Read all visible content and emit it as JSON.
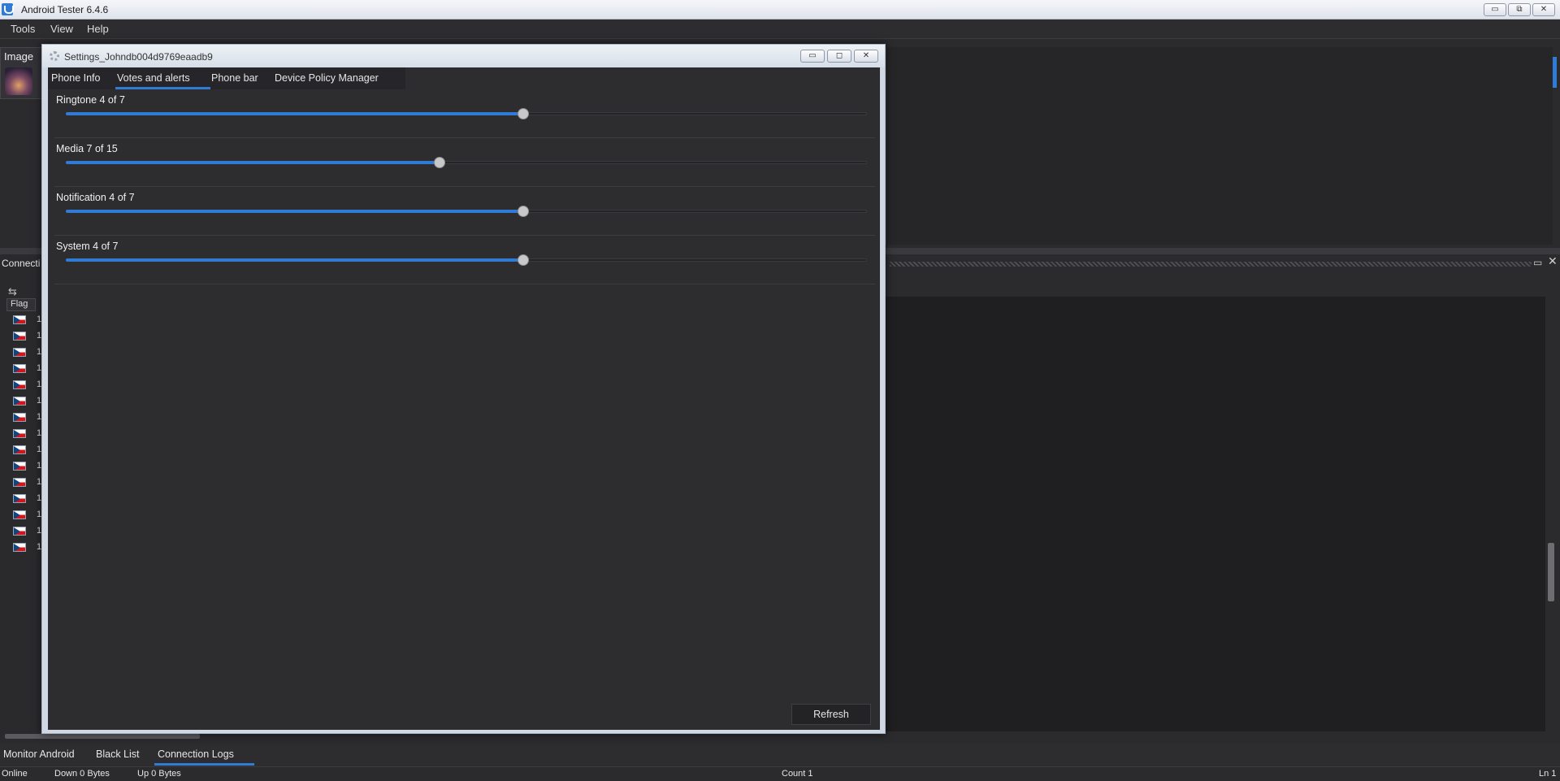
{
  "app": {
    "title": "Android Tester 6.4.6"
  },
  "window_controls": {
    "minimize": "▭",
    "restore": "⧉",
    "close": "✕"
  },
  "menu": [
    "Tools",
    "View",
    "Help"
  ],
  "image_panel": {
    "title": "Image"
  },
  "connection_panel": {
    "title": "Connecti",
    "toolbar_icon": "⇆",
    "column_header": "Flag",
    "row_prefixes": [
      "1",
      "1",
      "1",
      "1",
      "1",
      "1",
      "1",
      "1",
      "1",
      "1",
      "1",
      "1",
      "1",
      "1",
      "1"
    ]
  },
  "dialog": {
    "title": "Settings_Johndb004d9769eaadb9",
    "controls": {
      "minimize": "▭",
      "maximize": "◻",
      "close": "✕"
    },
    "tabs": [
      "Phone Info",
      "Votes and alerts",
      "Phone bar",
      "Device Policy Manager"
    ],
    "active_tab": "Votes and alerts",
    "volumes": [
      {
        "label": "Ringtone 4 of 7",
        "value": 4,
        "max": 7
      },
      {
        "label": "Media 7 of 15",
        "value": 7,
        "max": 15
      },
      {
        "label": "Notification 4 of 7",
        "value": 4,
        "max": 7
      },
      {
        "label": "System 4 of 7",
        "value": 4,
        "max": 7
      }
    ],
    "refresh_label": "Refresh"
  },
  "bottom_tabs": [
    "Monitor Android",
    "Black List",
    "Connection Logs"
  ],
  "active_bottom_tab": "Connection Logs",
  "status": {
    "online": "Online",
    "down": "Down 0 Bytes",
    "up": "Up 0 Bytes",
    "count": "Count 1",
    "line": "Ln 1"
  },
  "colors": {
    "accent": "#2f7bd6",
    "background": "#2d2d30"
  }
}
